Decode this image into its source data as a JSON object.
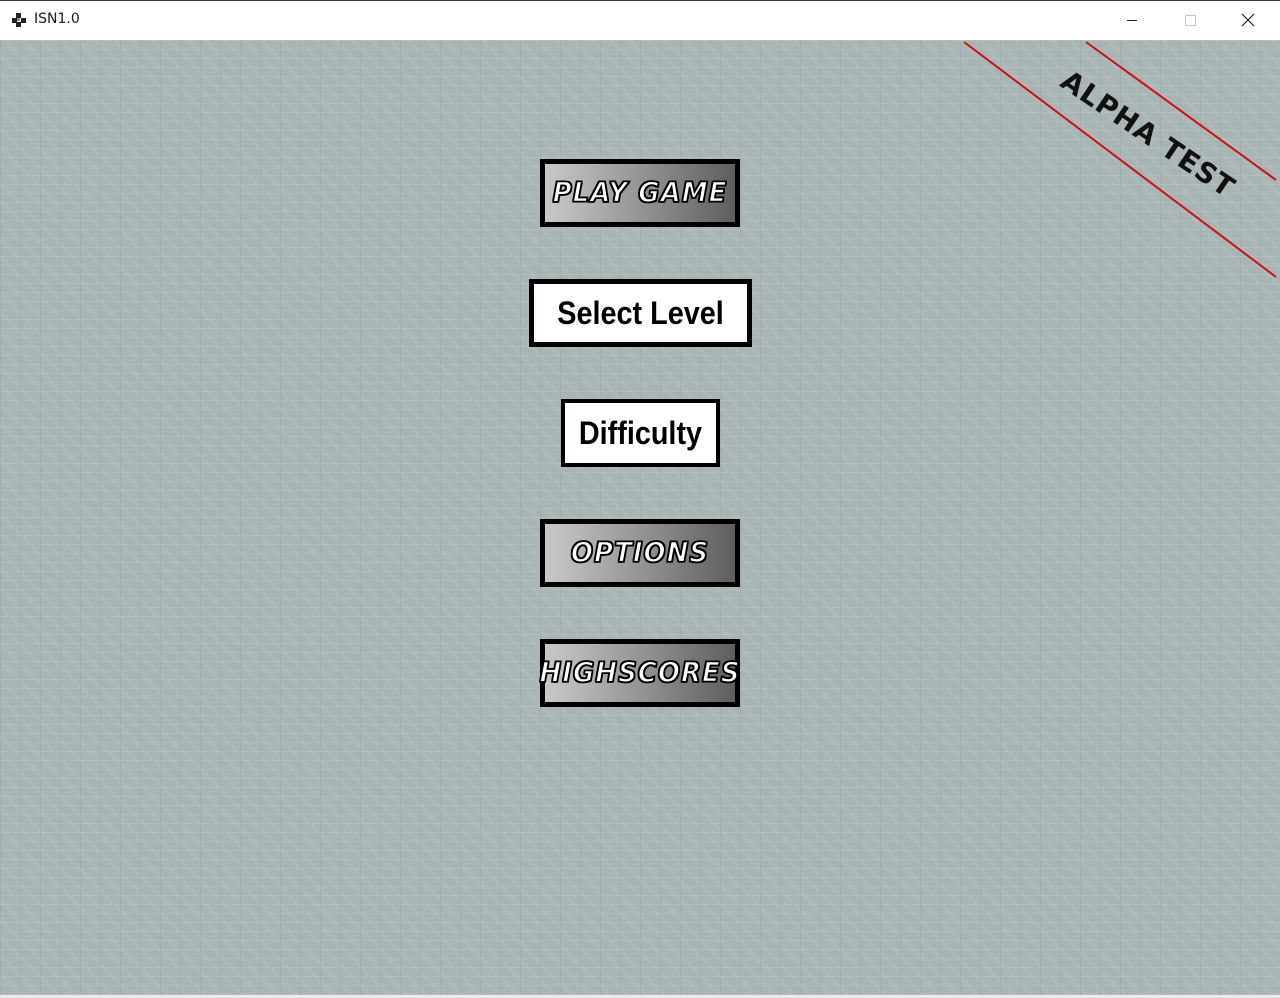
{
  "window": {
    "title": "ISN1.0",
    "app_icon": "game-controller-icon",
    "controls": [
      "minimize-icon",
      "maximize-icon",
      "close-icon"
    ]
  },
  "menu": {
    "play_game": "PLAY GAME",
    "select_level": "Select Level",
    "difficulty": "Difficulty",
    "options": "OPTIONS",
    "highscores": "HIGHSCORES"
  },
  "banner": {
    "label": "ALPHA TEST",
    "stripe_color": "#cc1111"
  },
  "colors": {
    "background": "#a9b5b5",
    "button_border": "#000000"
  }
}
